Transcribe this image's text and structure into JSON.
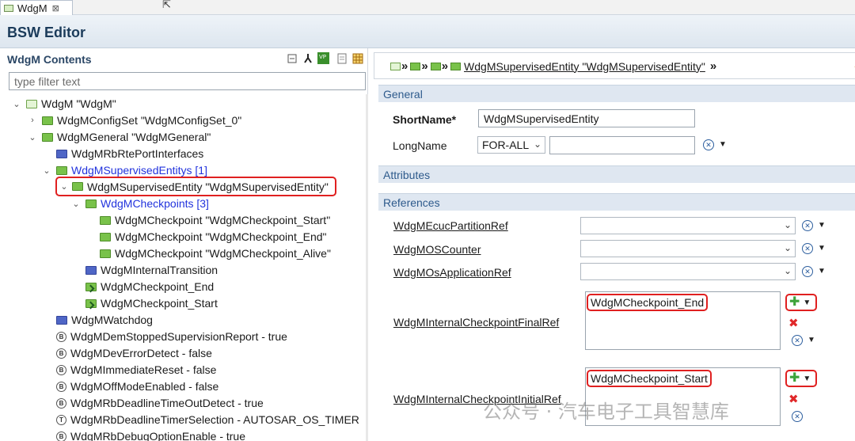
{
  "editor_tab": {
    "label": "WdgM",
    "close": "⊠"
  },
  "header": {
    "title": "BSW Editor"
  },
  "contents": {
    "title": "WdgM Contents",
    "filter_placeholder": "type filter text",
    "tree": [
      {
        "label": "WdgM \"WdgM\""
      },
      {
        "label": "WdgMConfigSet \"WdgMConfigSet_0\""
      },
      {
        "label": "WdgMGeneral \"WdgMGeneral\""
      },
      {
        "label": "WdgMRbRtePortInterfaces"
      },
      {
        "label": "WdgMSupervisedEntitys [1]"
      },
      {
        "label": "WdgMSupervisedEntity \"WdgMSupervisedEntity\""
      },
      {
        "label": "WdgMCheckpoints [3]"
      },
      {
        "label": "WdgMCheckpoint \"WdgMCheckpoint_Start\""
      },
      {
        "label": "WdgMCheckpoint \"WdgMCheckpoint_End\""
      },
      {
        "label": "WdgMCheckpoint \"WdgMCheckpoint_Alive\""
      },
      {
        "label": "WdgMInternalTransition"
      },
      {
        "label": "WdgMCheckpoint_End"
      },
      {
        "label": "WdgMCheckpoint_Start"
      },
      {
        "label": "WdgMWatchdog"
      },
      {
        "label": "WdgMDemStoppedSupervisionReport - true"
      },
      {
        "label": "WdgMDevErrorDetect - false"
      },
      {
        "label": "WdgMImmediateReset - false"
      },
      {
        "label": "WdgMOffModeEnabled - false"
      },
      {
        "label": "WdgMRbDeadlineTimeOutDetect - true"
      },
      {
        "label": "WdgMRbDeadlineTimerSelection - AUTOSAR_OS_TIMER"
      },
      {
        "label": "WdgMRbDebugOptionEnable - true"
      }
    ]
  },
  "breadcrumb": {
    "current": "WdgMSupervisedEntity \"WdgMSupervisedEntity\""
  },
  "general": {
    "section": "General",
    "short_name_label": "ShortName*",
    "short_name_value": "WdgMSupervisedEntity",
    "long_name_label": "LongName",
    "long_name_lang": "FOR-ALL",
    "long_name_value": ""
  },
  "attributes": {
    "section": "Attributes"
  },
  "references": {
    "section": "References",
    "ecuc_partition_ref": "WdgMEcucPartitionRef",
    "os_counter": "WdgMOSCounter",
    "os_application_ref": "WdgMOsApplicationRef",
    "final_ref_label": "WdgMInternalCheckpointFinalRef",
    "final_ref_item": "WdgMCheckpoint_End",
    "initial_ref_label": "WdgMInternalCheckpointInitialRef",
    "initial_ref_item": "WdgMCheckpoint_Start"
  },
  "watermark": "公众号 · 汽车电子工具智慧库",
  "colors": {
    "highlight": "#e02020",
    "link_blue": "#2233dd",
    "section_bg": "#dfe7f1",
    "folder_green": "#79c24a",
    "folder_blue": "#4f66c6"
  }
}
